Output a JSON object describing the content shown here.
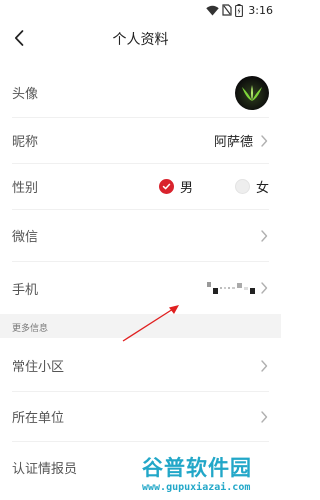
{
  "status_bar": {
    "time": "3:16"
  },
  "header": {
    "title": "个人资料"
  },
  "profile": {
    "avatar_label": "头像",
    "nickname_label": "昵称",
    "nickname_value": "阿萨德",
    "gender_label": "性别",
    "gender_options": [
      {
        "label": "男",
        "selected": true
      },
      {
        "label": "女",
        "selected": false
      }
    ],
    "wechat_label": "微信",
    "phone_label": "手机"
  },
  "more_info": {
    "title": "更多信息",
    "items": [
      {
        "label": "常住小区"
      },
      {
        "label": "所在单位"
      },
      {
        "label": "认证情报员"
      }
    ]
  },
  "watermark": {
    "brand": "谷普软件园",
    "url": "www.gupuxiazai.com"
  },
  "colors": {
    "accent": "#d9232d",
    "annotation_arrow": "#e02020",
    "watermark": "#22a7c8"
  }
}
